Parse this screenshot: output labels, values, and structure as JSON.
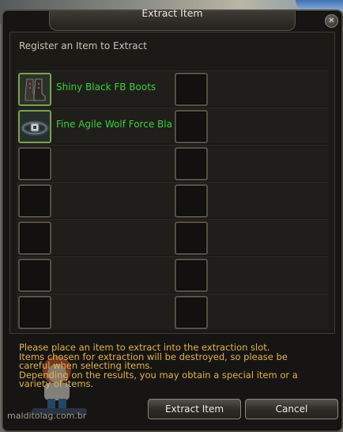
{
  "window": {
    "title": "Extract Item",
    "close_glyph": "✕"
  },
  "panel": {
    "header": "Register an Item to Extract"
  },
  "slots": {
    "left": [
      {
        "name": "Shiny Black FB Boots",
        "icon": "boots-icon"
      },
      {
        "name": "Fine Agile Wolf Force Bla",
        "icon": "belt-icon"
      },
      {
        "name": ""
      },
      {
        "name": ""
      },
      {
        "name": ""
      },
      {
        "name": ""
      },
      {
        "name": ""
      }
    ],
    "right": [
      {
        "name": ""
      },
      {
        "name": ""
      },
      {
        "name": ""
      },
      {
        "name": ""
      },
      {
        "name": ""
      },
      {
        "name": ""
      },
      {
        "name": ""
      }
    ]
  },
  "notes": {
    "line1": "Please place an item to extract into the extraction slot.",
    "line2": "Items chosen for extraction will be destroyed, so please be",
    "line3": "careful when selecting items.",
    "line4": "Depending on the results, you may obtain a special item or a",
    "line5": "variety of items."
  },
  "buttons": {
    "extract": "Extract Item",
    "cancel": "Cancel"
  },
  "watermark": "malditolag.com.br",
  "colors": {
    "item_name": "#39d139",
    "notes": "#e0b24c",
    "window_bg": "#171513"
  }
}
